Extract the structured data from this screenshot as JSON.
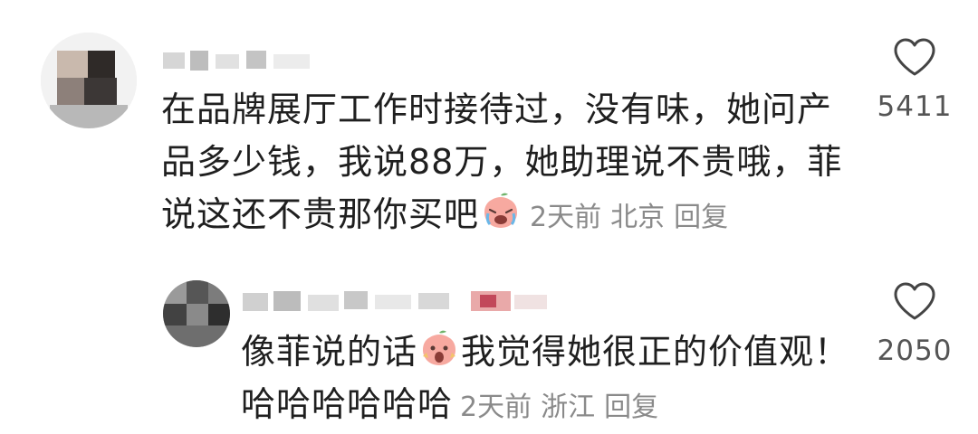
{
  "comments": [
    {
      "text_lines": [
        "在品牌展厅工作时接待过，没有味，她问产",
        "品多少钱，我说88万，她助理说不贵哦，菲",
        "说这还不贵那你买吧"
      ],
      "emoji": "crying-peach-emoji",
      "time": "2天前",
      "location": "北京",
      "reply_label": "回复",
      "likes": "5411"
    },
    {
      "text_lines": [
        "像菲说的话",
        "我觉得她很正的价值观！",
        "哈哈哈哈哈哈"
      ],
      "emoji": "shocked-peach-emoji",
      "time": "2天前",
      "location": "浙江",
      "reply_label": "回复",
      "likes": "2050"
    }
  ],
  "icons": {
    "like": "heart-outline-icon"
  },
  "colors": {
    "text": "#1f1f1f",
    "meta": "#8a8a8a",
    "emoji": "#f7a9a0"
  }
}
